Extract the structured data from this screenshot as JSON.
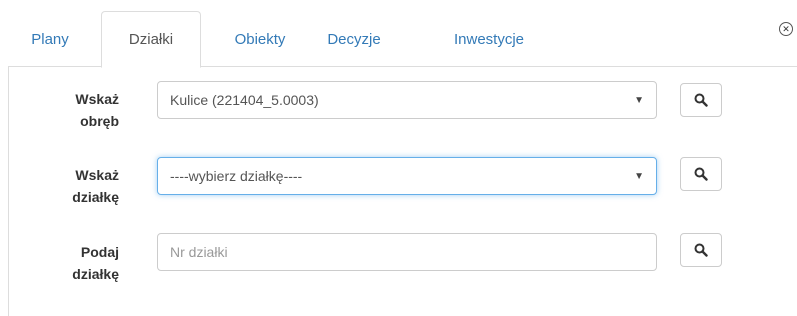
{
  "tabs": [
    {
      "label": "Plany"
    },
    {
      "label": "Działki"
    },
    {
      "label": "Obiekty"
    },
    {
      "label": "Decyzje"
    },
    {
      "label": "Inwestycje"
    }
  ],
  "active_tab": "Działki",
  "close_icon": "circle-x-icon",
  "form": {
    "obreb": {
      "label_line1": "Wskaż",
      "label_line2": "obręb",
      "value": "Kulice (221404_5.0003)"
    },
    "dzialka": {
      "label_line1": "Wskaż",
      "label_line2": "działkę",
      "value": "----wybierz działkę----"
    },
    "podaj": {
      "label_line1": "Podaj",
      "label_line2": "działkę",
      "placeholder": "Nr działki"
    }
  },
  "search_icon": "magnifier-icon"
}
